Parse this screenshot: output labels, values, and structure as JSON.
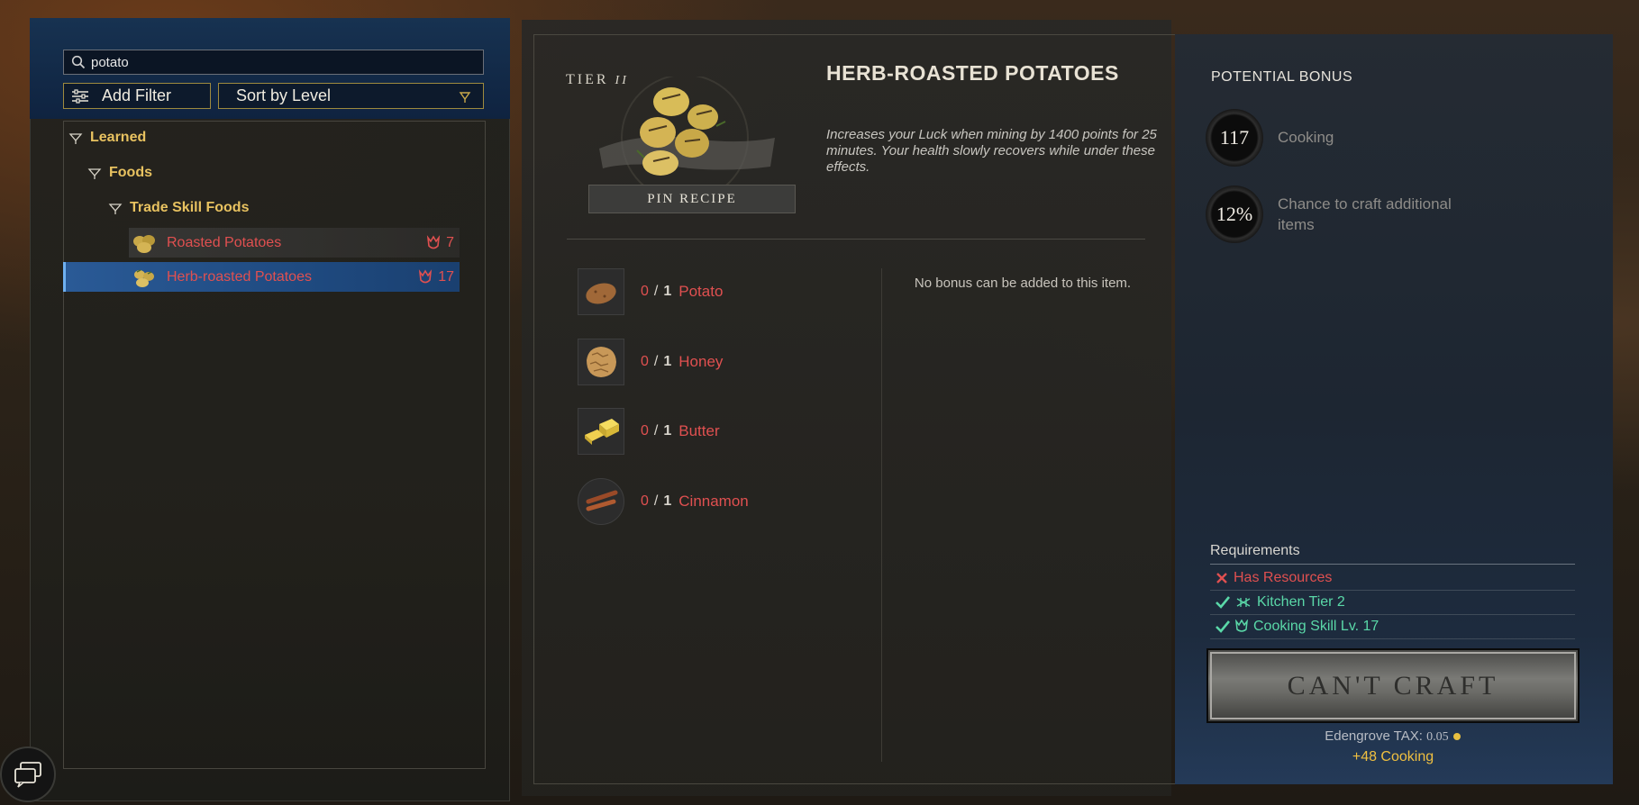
{
  "search": {
    "value": "potato",
    "placeholder": ""
  },
  "filters": {
    "add_filter_label": "Add Filter",
    "sort_label": "Sort by Level"
  },
  "tree": {
    "learned": "Learned",
    "foods": "Foods",
    "trade_skill_foods": "Trade Skill Foods"
  },
  "recipes": [
    {
      "name": "Roasted Potatoes",
      "level": "7"
    },
    {
      "name": "Herb-roasted Potatoes",
      "level": "17"
    }
  ],
  "recipe": {
    "tier_label": "TIER",
    "tier_roman": "II",
    "title": "HERB-ROASTED POTATOES",
    "description": "Increases your Luck when mining by 1400 points for 25 minutes. Your health slowly recovers while under these effects.",
    "pin_label": "PIN RECIPE"
  },
  "ingredients": [
    {
      "have": "0",
      "sep": "/",
      "need": "1",
      "name": "Potato"
    },
    {
      "have": "0",
      "sep": "/",
      "need": "1",
      "name": "Honey"
    },
    {
      "have": "0",
      "sep": "/",
      "need": "1",
      "name": "Butter"
    },
    {
      "have": "0",
      "sep": "/",
      "need": "1",
      "name": "Cinnamon"
    }
  ],
  "no_bonus_text": "No bonus can be added to this item.",
  "potential_bonus": {
    "title": "POTENTIAL BONUS",
    "skill_value": "117",
    "skill_label": "Cooking",
    "chance_value": "12%",
    "chance_label": "Chance to craft additional items"
  },
  "requirements": {
    "title": "Requirements",
    "items": [
      {
        "label": "Has Resources",
        "met": false
      },
      {
        "label": "Kitchen Tier 2",
        "met": true
      },
      {
        "label": "Cooking Skill Lv. 17",
        "met": true
      }
    ]
  },
  "craft": {
    "button_label": "CAN'T CRAFT",
    "tax_label": "Edengrove TAX:",
    "tax_value": "0.05",
    "xp_label": "+48 Cooking"
  },
  "colors": {
    "accent_gold": "#e8c260",
    "unmet_red": "#e05050",
    "met_green": "#5ad8a8",
    "selected_blue": "#2a5a96"
  }
}
